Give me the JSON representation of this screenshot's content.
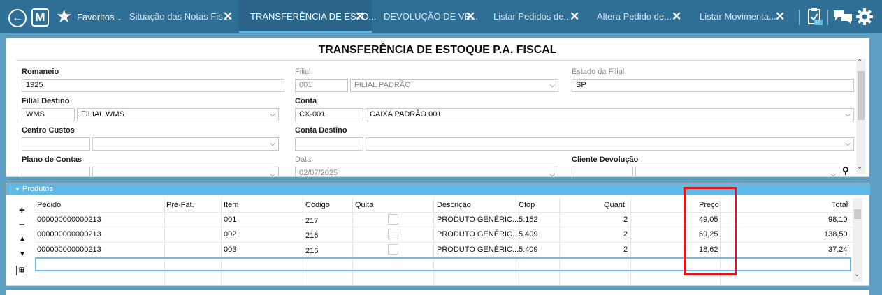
{
  "topbar": {
    "favorites_label": "Favoritos",
    "tabs": [
      {
        "label": "Situação das Notas Fis...",
        "active": false
      },
      {
        "label": "TRANSFERÊNCIA DE ESTO...",
        "active": true
      },
      {
        "label": "DEVOLUÇÃO DE VE...",
        "active": false
      },
      {
        "label": "Listar Pedidos de...",
        "active": false
      },
      {
        "label": "Altera Pedido de...",
        "active": false
      },
      {
        "label": "Listar Movimenta...",
        "active": false
      }
    ],
    "notification_count": "17"
  },
  "form": {
    "title": "TRANSFERÊNCIA DE ESTOQUE P.A. FISCAL",
    "romaneio_label": "Romaneio",
    "romaneio_value": "1925",
    "filial_label": "Filial",
    "filial_code": "001",
    "filial_name": "FILIAL PADRÃO",
    "estado_label": "Estado da Filial",
    "estado_value": "SP",
    "filial_destino_label": "Filial Destino",
    "filial_destino_code": "WMS",
    "filial_destino_name": "FILIAL WMS",
    "conta_label": "Conta",
    "conta_code": "CX-001",
    "conta_name": "CAIXA PADRÃO 001",
    "centro_custos_label": "Centro Custos",
    "conta_destino_label": "Conta Destino",
    "plano_contas_label": "Plano de Contas",
    "data_label": "Data",
    "data_value": "02/07/2025",
    "cliente_devolucao_label": "Cliente Devolução"
  },
  "produtos": {
    "header": "Produtos",
    "columns": [
      "Pedido",
      "Pré-Fat.",
      "Item",
      "Código",
      "Quita",
      "Descrição",
      "Cfop",
      "Quant.",
      "Preço",
      "Total"
    ],
    "rows": [
      {
        "pedido": "000000000000213",
        "prefat": "",
        "item": "001",
        "codigo": "217",
        "descricao": "PRODUTO GENÉRIC...",
        "cfop": "5.152",
        "quant": "2",
        "preco": "49,05",
        "total": "98,10"
      },
      {
        "pedido": "000000000000213",
        "prefat": "",
        "item": "002",
        "codigo": "216",
        "descricao": "PRODUTO GENÉRIC...",
        "cfop": "5.409",
        "quant": "2",
        "preco": "69,25",
        "total": "138,50"
      },
      {
        "pedido": "000000000000213",
        "prefat": "",
        "item": "003",
        "codigo": "216",
        "descricao": "PRODUTO GENÉRIC...",
        "cfop": "5.409",
        "quant": "2",
        "preco": "18,62",
        "total": "37,24"
      }
    ]
  },
  "colors": {
    "topbar": "#2f6f96",
    "section_header": "#5fb8e6",
    "highlight": "#e2141b"
  }
}
